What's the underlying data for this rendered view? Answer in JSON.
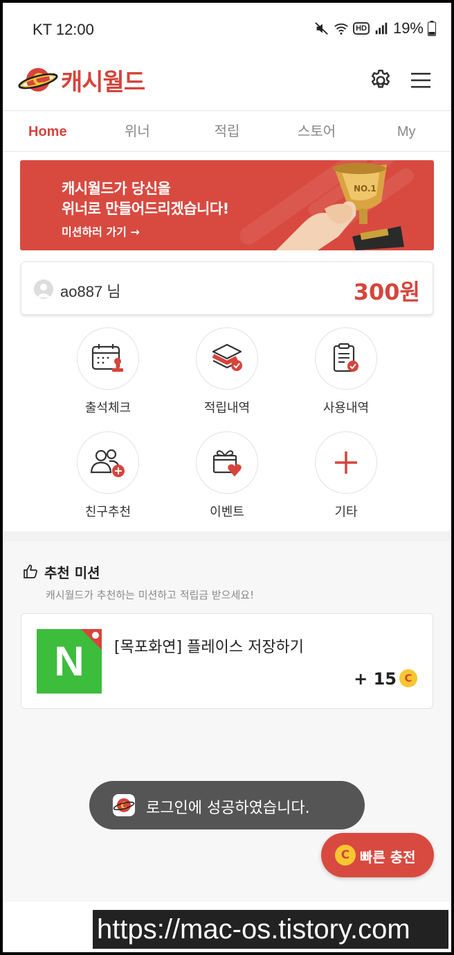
{
  "status_bar": {
    "carrier_time": "KT 12:00",
    "battery": "19%",
    "hd": "HD"
  },
  "header": {
    "logo_text": "캐시월드"
  },
  "tabs": [
    {
      "label": "Home",
      "active": true
    },
    {
      "label": "위너",
      "active": false
    },
    {
      "label": "적립",
      "active": false
    },
    {
      "label": "스토어",
      "active": false
    },
    {
      "label": "My",
      "active": false
    }
  ],
  "banner": {
    "line1": "캐시월드가 당신을",
    "line2": "위너로 만들어드리겠습니다!",
    "cta": "미션하러 가기 →",
    "trophy_text": "NO.1"
  },
  "user": {
    "name": "ao887 님",
    "balance": "300원"
  },
  "menu": [
    {
      "label": "출석체크",
      "icon": "calendar-check-icon"
    },
    {
      "label": "적립내역",
      "icon": "layers-check-icon"
    },
    {
      "label": "사용내역",
      "icon": "clipboard-check-icon"
    },
    {
      "label": "친구추천",
      "icon": "add-friend-icon"
    },
    {
      "label": "이벤트",
      "icon": "gift-heart-icon"
    },
    {
      "label": "기타",
      "icon": "plus-icon"
    }
  ],
  "mission": {
    "title": "추천 미션",
    "subtitle": "캐시월드가 추천하는 미션하고 적립금 받으세요!",
    "card": {
      "logo_letter": "N",
      "title": "[목포화연] 플레이스 저장하기",
      "points": "+ 15",
      "coin_glyph": "C"
    }
  },
  "toast": {
    "text": "로그인에 성공하였습니다."
  },
  "fab": {
    "coin_glyph": "C",
    "label": "빠른 충전"
  },
  "watermark": "https://mac-os.tistory.com",
  "colors": {
    "accent": "#d6443c",
    "banner": "#d84a40",
    "naver_green": "#3cbd3c",
    "coin_yellow": "#f7c630"
  }
}
